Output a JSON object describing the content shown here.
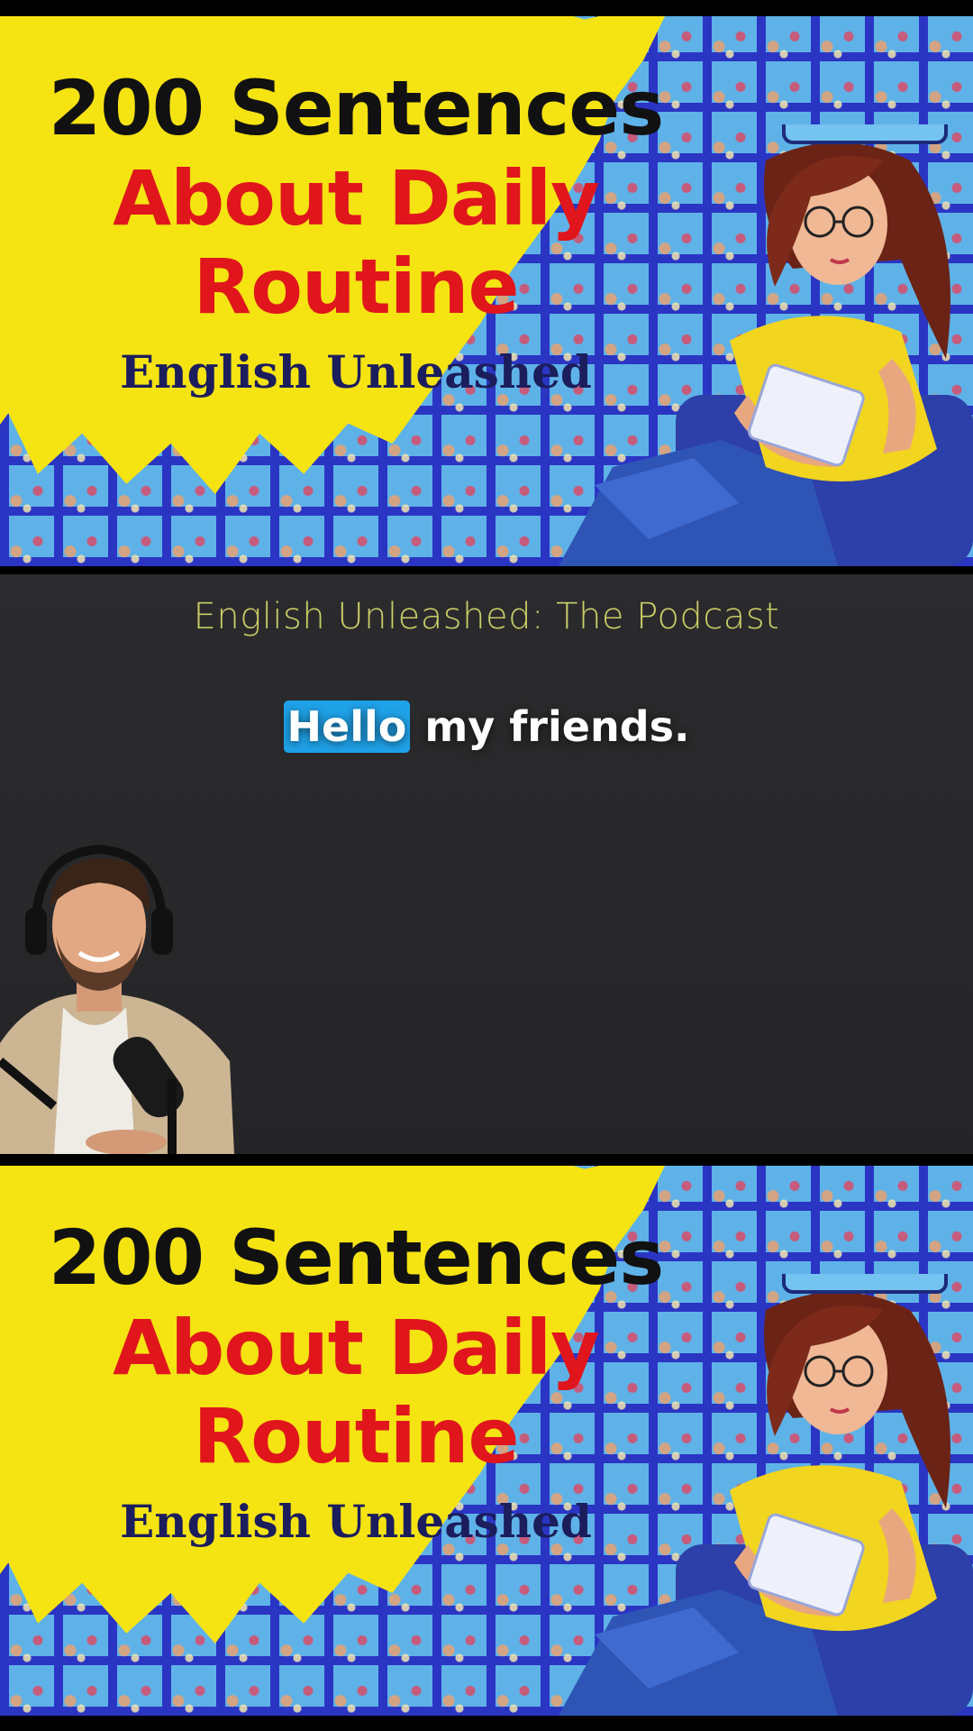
{
  "thumbnail": {
    "line1": "200 Sentences",
    "line2": "About Daily",
    "line3": "Routine",
    "brand": "English Unleashed"
  },
  "podcast": {
    "title": "English Unleashed: The Podcast",
    "caption_highlight": "Hello",
    "caption_rest": " my friends."
  },
  "colors": {
    "splash_yellow": "#f6e312",
    "headline_red": "#e0161c",
    "title_green": "#c9ce67",
    "highlight_blue": "#1fa2e8",
    "tile_blue": "#2b35c4"
  },
  "icons": {
    "host": "podcast-host-illustration",
    "woman": "woman-writing-illustration"
  }
}
